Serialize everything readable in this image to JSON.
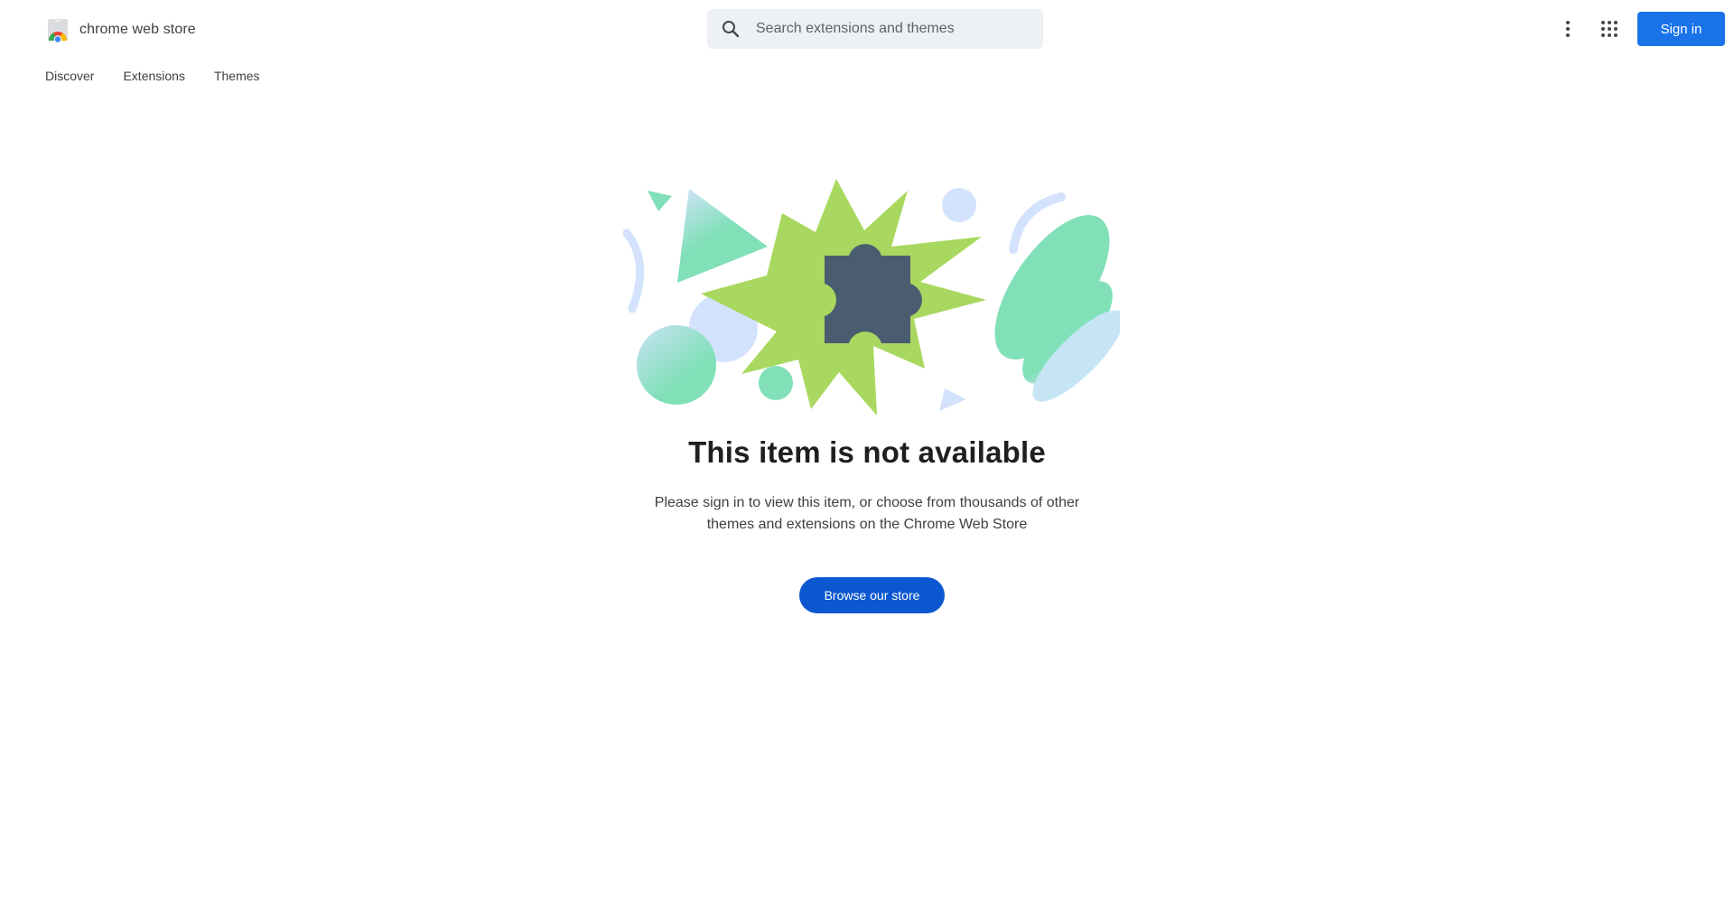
{
  "header": {
    "brand_name": "chrome web store",
    "search_placeholder": "Search extensions and themes",
    "more_options_icon": "more-vert-icon",
    "apps_icon": "apps-grid-icon",
    "signin_label": "Sign in"
  },
  "nav": {
    "items": [
      {
        "label": "Discover"
      },
      {
        "label": "Extensions"
      },
      {
        "label": "Themes"
      }
    ]
  },
  "main": {
    "illustration_icon": "puzzle-piece-icon",
    "title": "This item is not available",
    "message": "Please sign in to view this item, or choose from thousands of other themes and extensions on the Chrome Web Store",
    "browse_label": "Browse our store"
  },
  "colors": {
    "primary_blue": "#1a73e8",
    "browse_blue": "#0b57d0",
    "search_bg": "#edf1f6",
    "illustration_green": "#a8d85f",
    "illustration_teal": "#81e0b8",
    "illustration_light_blue": "#d3e3fd",
    "puzzle_slate": "#4a5d70"
  }
}
